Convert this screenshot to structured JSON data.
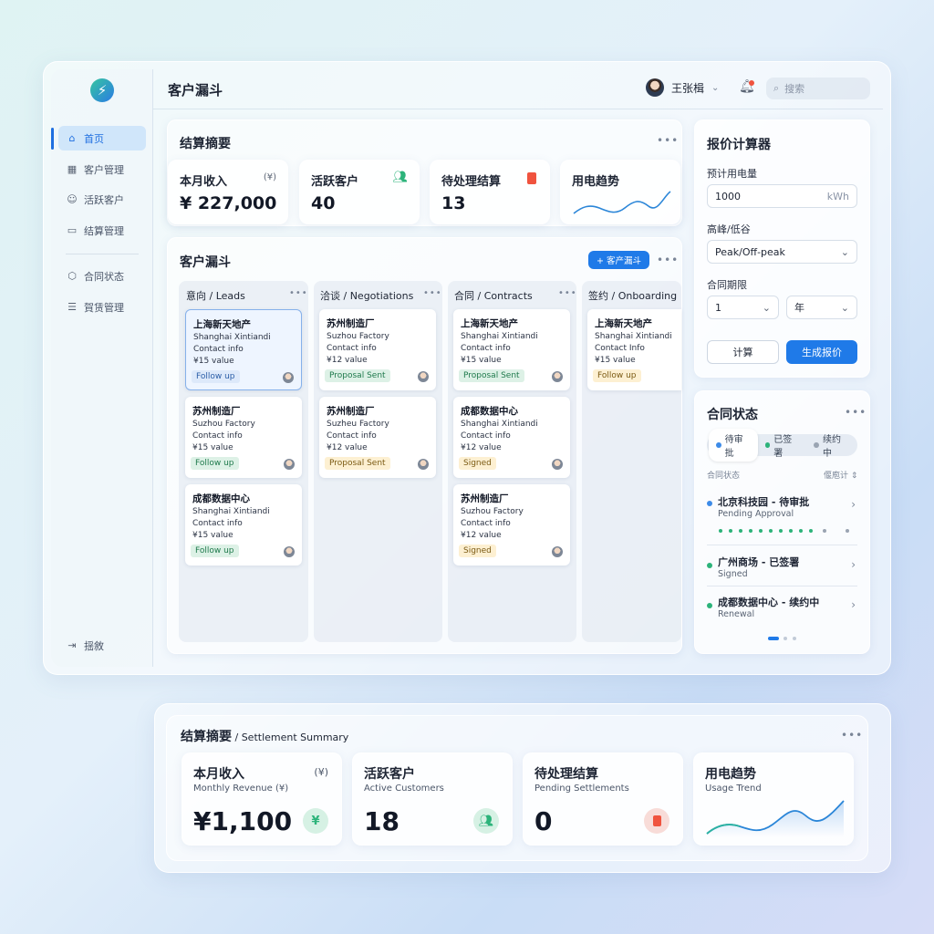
{
  "app": {
    "page_title": "客户漏斗"
  },
  "sidebar": {
    "logo_glyph": "⚡",
    "items": [
      {
        "label": "首页",
        "icon": "home-icon"
      },
      {
        "label": "客户管理",
        "icon": "grid-icon"
      },
      {
        "label": "活跃客户",
        "icon": "users-icon"
      },
      {
        "label": "结算管理",
        "icon": "folder-icon"
      },
      {
        "label": "合同状态",
        "icon": "shield-icon"
      },
      {
        "label": "賀赁管理",
        "icon": "list-icon"
      }
    ],
    "logout_label": "揺敘"
  },
  "header": {
    "user_name": "王张楫",
    "search_placeholder": "搜索"
  },
  "summary": {
    "title": "结算摘要",
    "cards": [
      {
        "title": "本月收入",
        "unit": "(¥)",
        "value": "¥ 227,000"
      },
      {
        "title": "活跃客户",
        "value": "40"
      },
      {
        "title": "待处理结算",
        "value": "13"
      },
      {
        "title": "用电趋势"
      }
    ]
  },
  "funnel": {
    "title": "客户漏斗",
    "add_button": "+ 客产漏斗",
    "columns": [
      {
        "header": "意向 / Leads",
        "cards": [
          {
            "title": "上海新天地产",
            "en": "Shanghai Xintiandi",
            "contact": "Contact info",
            "value": "¥15 value",
            "tag": "Follow up",
            "tag_type": "fu0"
          },
          {
            "title": "苏州制造厂",
            "en": "Suzhou Factory",
            "contact": "Contact info",
            "value": "¥15 value",
            "tag": "Follow up",
            "tag_type": "fu"
          },
          {
            "title": "成都数据中心",
            "en": "Shanghai Xintiandi",
            "contact": "Contact info",
            "value": "¥15 value",
            "tag": "Follow up",
            "tag_type": "fu"
          }
        ]
      },
      {
        "header": "洽谈 / Negotiations",
        "cards": [
          {
            "title": "苏州制造厂",
            "en": "Suzhou Factory",
            "contact": "Contact info",
            "value": "¥12 value",
            "tag": "Proposal Sent",
            "tag_type": "ps"
          },
          {
            "title": "苏州制造厂",
            "en": "Suzheu Factory",
            "contact": "Contact info",
            "value": "¥12 value",
            "tag": "Proposal Sent",
            "tag_type": "sg"
          }
        ]
      },
      {
        "header": "合同 / Contracts",
        "cards": [
          {
            "title": "上海新天地产",
            "en": "Shanghai Xintiandi",
            "contact": "Contact info",
            "value": "¥15 value",
            "tag": "Proposal Sent",
            "tag_type": "ps"
          },
          {
            "title": "成都数据中心",
            "en": "Shanghai Xintiandi",
            "contact": "Contact info",
            "value": "¥12 value",
            "tag": "Signed",
            "tag_type": "sg"
          },
          {
            "title": "苏州制造厂",
            "en": "Suzhou Factory",
            "contact": "Contact info",
            "value": "¥12 value",
            "tag": "Signed",
            "tag_type": "sg"
          }
        ]
      },
      {
        "header": "签约 / Onboarding",
        "cards": [
          {
            "title": "上海新天地产",
            "en": "Shanghai Xintiandi",
            "contact": "Contact Info",
            "value": "¥15 value",
            "tag": "Follow up",
            "tag_type": "sg"
          }
        ]
      }
    ]
  },
  "calculator": {
    "title": "报价计算器",
    "usage_label": "预计用电量",
    "usage_value": "1000",
    "usage_unit": "kWh",
    "peak_label": "高峰/低谷",
    "peak_value": "Peak/Off-peak",
    "term_label": "合同期限",
    "term_value": "1",
    "term_unit": "年",
    "calc_button": "计算",
    "generate_button": "生成报价"
  },
  "contracts": {
    "title": "合同状态",
    "segments": [
      "待审批",
      "已签署",
      "续约中"
    ],
    "list_label": "合同状态",
    "sort_label": "偃庖计 ⇕",
    "items": [
      {
        "title": "北京科技园 - 待审批",
        "sub": "Pending Approval",
        "color": "#3d8be8"
      },
      {
        "title": "广州商场 - 已签署",
        "sub": "Signed",
        "color": "#2cb37a"
      },
      {
        "title": "成都数据中心 - 续约中",
        "sub": "Renewal",
        "color": "#2cb37a"
      }
    ]
  },
  "bottom_summary": {
    "title": "结算摘要",
    "subtitle": " / Settlement Summary",
    "cards": [
      {
        "title": "本月收入",
        "unit": "(¥)",
        "sub": "Monthly Revenue (¥)",
        "value": "¥1,100",
        "icon": "¥"
      },
      {
        "title": "活跃客户",
        "sub": "Active Customers",
        "value": "18",
        "icon": "users-icon"
      },
      {
        "title": "待处理结算",
        "sub": "Pending Settlements",
        "value": "0",
        "icon": "document-icon"
      },
      {
        "title": "用电趋势",
        "sub": "Usage Trend"
      }
    ]
  },
  "colors": {
    "accent": "#1f7ae8",
    "green": "#2cb37a",
    "red": "#f0533e"
  }
}
